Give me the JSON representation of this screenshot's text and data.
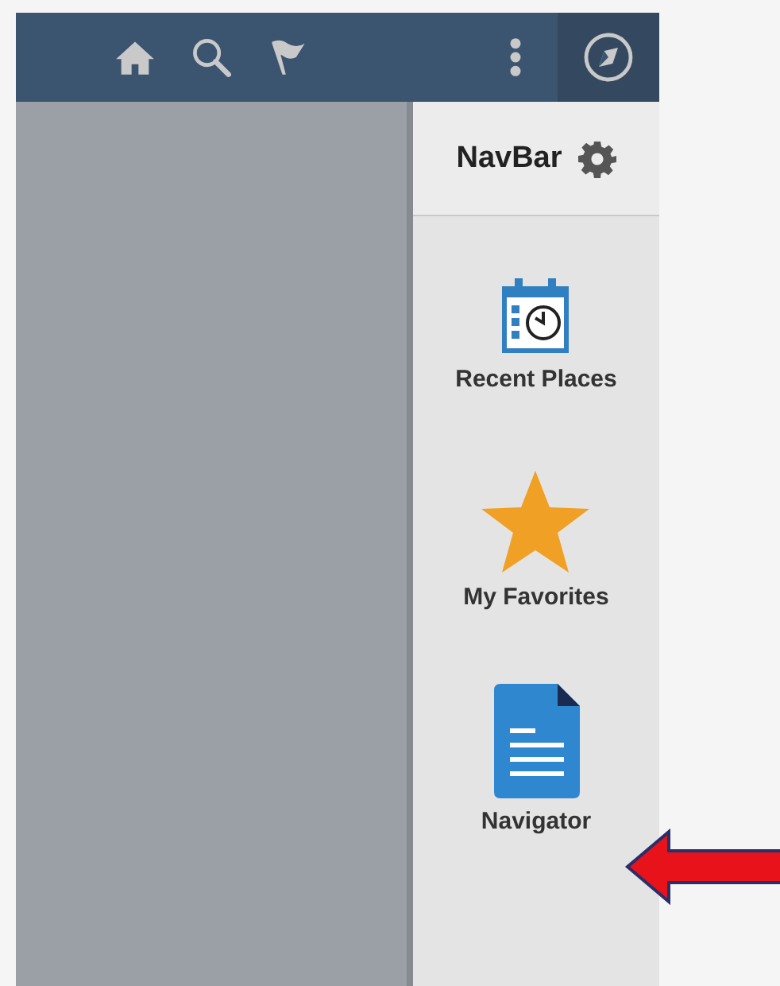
{
  "navbar": {
    "title": "NavBar",
    "items": [
      {
        "kind": "recent",
        "label": "Recent Places"
      },
      {
        "kind": "favorites",
        "label": "My Favorites"
      },
      {
        "kind": "navigator",
        "label": "Navigator"
      }
    ]
  }
}
